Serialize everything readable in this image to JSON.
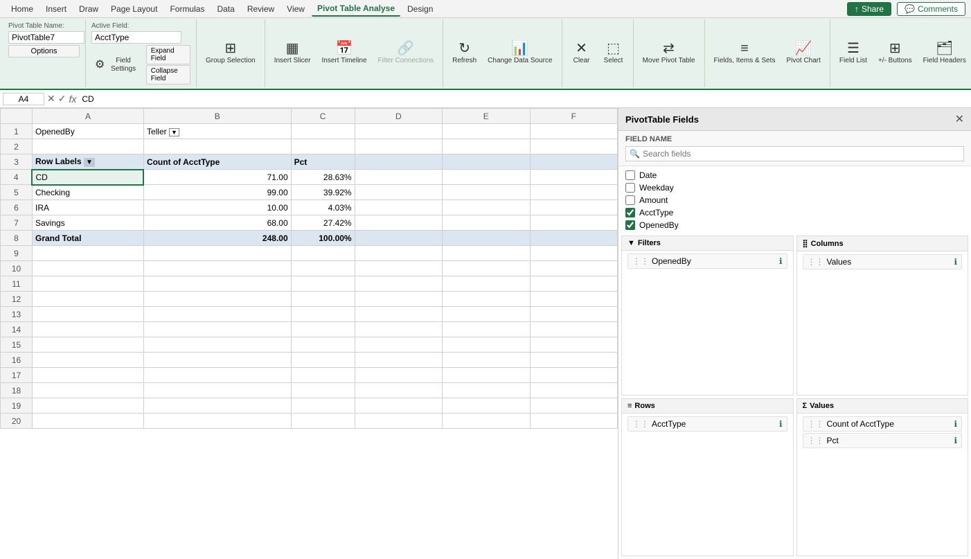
{
  "menubar": {
    "items": [
      "Home",
      "Insert",
      "Draw",
      "Page Layout",
      "Formulas",
      "Data",
      "Review",
      "View",
      "Pivot Table Analyse",
      "Design"
    ],
    "active": "Pivot Table Analyse",
    "share_label": "Share",
    "comments_label": "Comments"
  },
  "ribbon": {
    "pivot_name_label": "Pivot Table Name:",
    "pivot_name_value": "PivotTable7",
    "options_label": "Options",
    "active_field_label": "Active Field:",
    "active_field_value": "AcctType",
    "field_settings_label": "Field\nSettings",
    "expand_field_label": "Expand Field",
    "collapse_field_label": "Collapse Field",
    "group_selection_label": "Group\nSelection",
    "insert_slicer_label": "Insert\nSlicer",
    "insert_timeline_label": "Insert\nTimeline",
    "filter_connections_label": "Filter\nConnections",
    "refresh_label": "Refresh",
    "change_data_source_label": "Change\nData Source",
    "clear_label": "Clear",
    "select_label": "Select",
    "move_pivot_table_label": "Move\nPivot Table",
    "fields_items_sets_label": "Fields,\nItems & Sets",
    "pivot_chart_label": "Pivot\nChart",
    "field_list_label": "Field\nList",
    "plus_minus_buttons_label": "+/-\nButtons",
    "field_headers_label": "Field\nHeaders"
  },
  "formula_bar": {
    "cell_ref": "A4",
    "formula_value": "CD"
  },
  "spreadsheet": {
    "col_headers": [
      "",
      "A",
      "B",
      "C",
      "D",
      "E",
      "F"
    ],
    "row_headers": [
      "1",
      "2",
      "3",
      "4",
      "5",
      "6",
      "7",
      "8",
      "9",
      "10",
      "11",
      "12",
      "13",
      "14",
      "15",
      "16",
      "17",
      "18",
      "19",
      "20"
    ],
    "filter_cell": "B1",
    "rows": [
      {
        "row": "1",
        "A": "OpenedBy",
        "B": "Teller",
        "C": "",
        "D": "",
        "E": "",
        "F": "",
        "B_has_filter": true
      },
      {
        "row": "2",
        "A": "",
        "B": "",
        "C": "",
        "D": "",
        "E": "",
        "F": ""
      },
      {
        "row": "3",
        "A": "Row Labels",
        "B": "Count of AcctType",
        "C": "Pct",
        "D": "",
        "E": "",
        "F": "",
        "is_header": true,
        "A_has_dropdown": true
      },
      {
        "row": "4",
        "A": "CD",
        "B": "71.00",
        "C": "28.63%",
        "D": "",
        "E": "",
        "F": "",
        "is_selected_A": true
      },
      {
        "row": "5",
        "A": "Checking",
        "B": "99.00",
        "C": "39.92%",
        "D": "",
        "E": "",
        "F": ""
      },
      {
        "row": "6",
        "A": "IRA",
        "B": "10.00",
        "C": "4.03%",
        "D": "",
        "E": "",
        "F": ""
      },
      {
        "row": "7",
        "A": "Savings",
        "B": "68.00",
        "C": "27.42%",
        "D": "",
        "E": "",
        "F": ""
      },
      {
        "row": "8",
        "A": "Grand Total",
        "B": "248.00",
        "C": "100.00%",
        "D": "",
        "E": "",
        "F": "",
        "is_total": true
      },
      {
        "row": "9",
        "A": "",
        "B": "",
        "C": "",
        "D": "",
        "E": "",
        "F": ""
      },
      {
        "row": "10",
        "A": "",
        "B": "",
        "C": "",
        "D": "",
        "E": "",
        "F": ""
      },
      {
        "row": "11",
        "A": "",
        "B": "",
        "C": "",
        "D": "",
        "E": "",
        "F": ""
      },
      {
        "row": "12",
        "A": "",
        "B": "",
        "C": "",
        "D": "",
        "E": "",
        "F": ""
      },
      {
        "row": "13",
        "A": "",
        "B": "",
        "C": "",
        "D": "",
        "E": "",
        "F": ""
      },
      {
        "row": "14",
        "A": "",
        "B": "",
        "C": "",
        "D": "",
        "E": "",
        "F": ""
      },
      {
        "row": "15",
        "A": "",
        "B": "",
        "C": "",
        "D": "",
        "E": "",
        "F": ""
      },
      {
        "row": "16",
        "A": "",
        "B": "",
        "C": "",
        "D": "",
        "E": "",
        "F": ""
      },
      {
        "row": "17",
        "A": "",
        "B": "",
        "C": "",
        "D": "",
        "E": "",
        "F": ""
      },
      {
        "row": "18",
        "A": "",
        "B": "",
        "C": "",
        "D": "",
        "E": "",
        "F": ""
      },
      {
        "row": "19",
        "A": "",
        "B": "",
        "C": "",
        "D": "",
        "E": "",
        "F": ""
      },
      {
        "row": "20",
        "A": "",
        "B": "",
        "C": "",
        "D": "",
        "E": "",
        "F": ""
      }
    ]
  },
  "pivot_panel": {
    "title": "PivotTable Fields",
    "field_name_label": "FIELD NAME",
    "search_placeholder": "Search fields",
    "fields": [
      {
        "name": "Date",
        "checked": false
      },
      {
        "name": "Weekday",
        "checked": false
      },
      {
        "name": "Amount",
        "checked": false
      },
      {
        "name": "AcctType",
        "checked": true
      },
      {
        "name": "OpenedBy",
        "checked": true
      }
    ],
    "filters_label": "Filters",
    "columns_label": "Columns",
    "rows_label": "Rows",
    "values_label": "Values",
    "filters_items": [
      "OpenedBy"
    ],
    "columns_items": [
      "Values"
    ],
    "rows_items": [
      "AcctType"
    ],
    "values_items": [
      "Count of AcctType",
      "Pct"
    ]
  },
  "colors": {
    "green_accent": "#217346",
    "ribbon_bg": "#e8f2ec",
    "header_bg": "#dce6f1",
    "selected_green": "#e8f2ec"
  }
}
